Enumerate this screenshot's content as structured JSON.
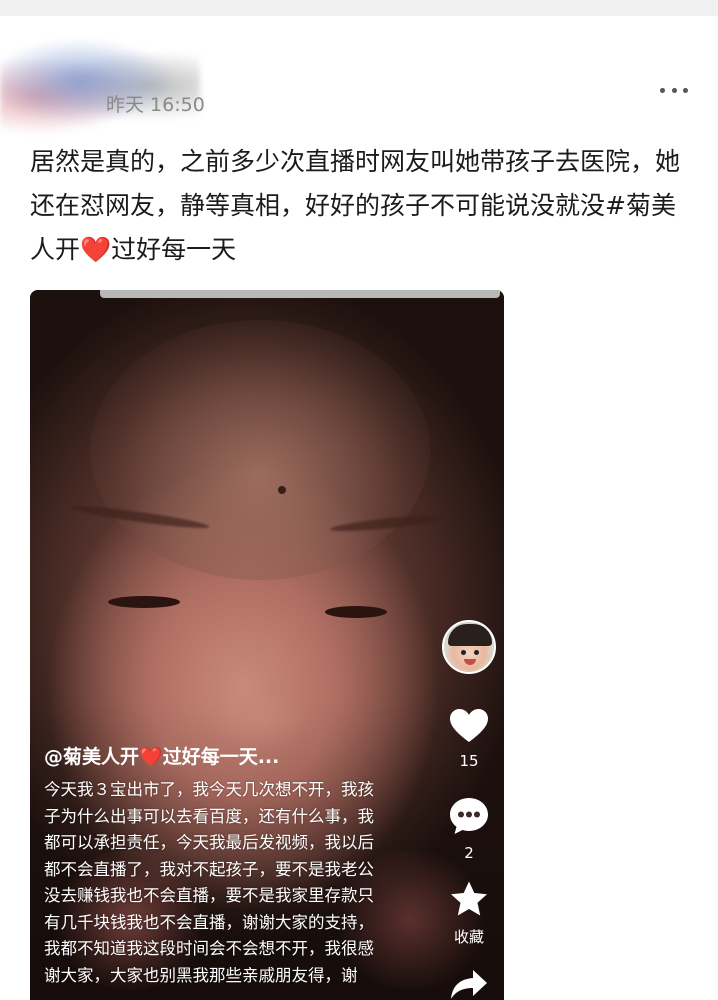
{
  "header": {
    "timestamp": "昨天 16:50",
    "more_icon": "more-horizontal-icon"
  },
  "post": {
    "text_main": "居然是真的，之前多少次直播时网友叫她带孩子去医院，她还在怼网友，静等真相，好好的孩子不可能说没就没#菊美人开",
    "heart_emoji": "❤️",
    "text_tail": "过好每一天"
  },
  "video": {
    "caption_user_prefix": "@菊美人开",
    "caption_user_heart": "❤️",
    "caption_user_suffix": "过好每一天...",
    "caption_body": "今天我３宝出市了，我今天几次想不开，我孩子为什么出事可以去看百度，还有什么事，我都可以承担责任，今天我最后发视频，我以后都不会直播了，我对不起孩子，要不是我老公没去赚钱我也不会直播，要不是我家里存款只有几千块钱我也不会直播，谢谢大家的支持，我都不知道我这段时间会不会想不开，我很感谢大家，大家也别黑我那些亲戚朋友得，谢",
    "likes": "15",
    "comments": "2",
    "favorite_label": "收藏",
    "icons": {
      "like": "heart-icon",
      "comment": "comment-icon",
      "favorite": "star-icon",
      "share": "share-icon"
    }
  },
  "colors": {
    "heart": "#e0262b",
    "timestamp": "#8a8a8a",
    "text": "#1b1b1b"
  }
}
